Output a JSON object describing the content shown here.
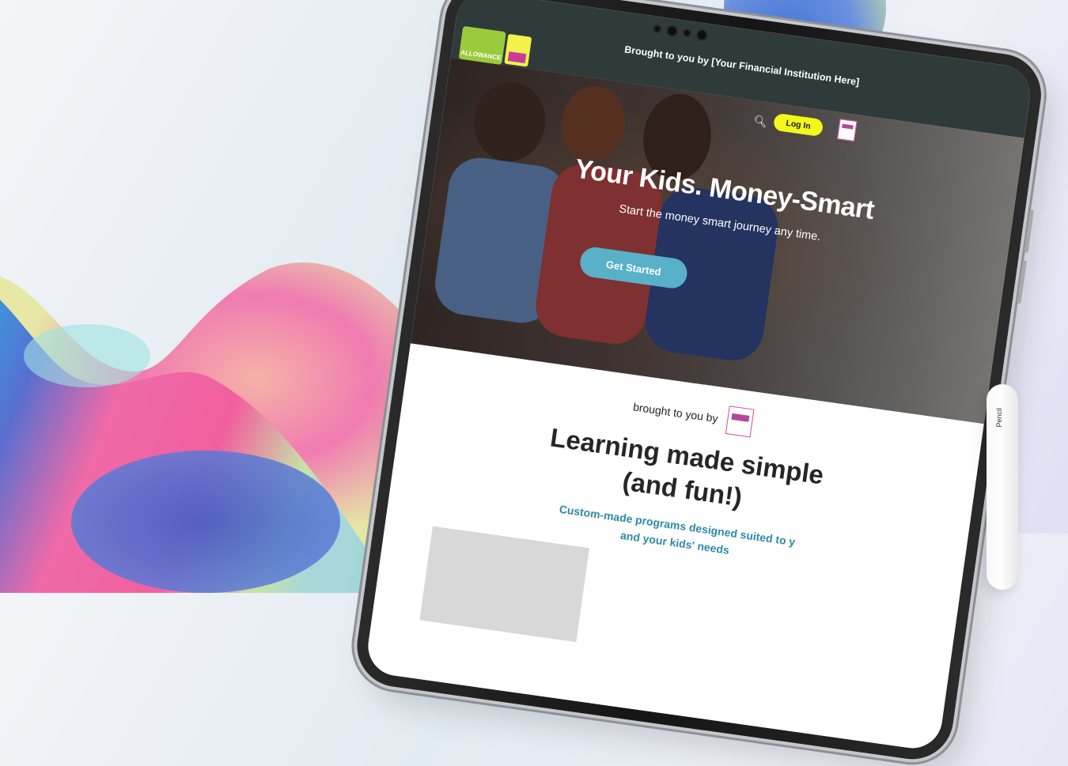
{
  "tablet": {
    "top_banner": "Brought to you by [Your Financial Institution Here]",
    "header": {
      "logo_text": "ALLOWANCE",
      "login_label": "Log In"
    },
    "hero": {
      "title": "Your Kids. Money-Smart",
      "subtitle": "Start the money smart journey any time.",
      "cta_label": "Get Started"
    },
    "content": {
      "brought_by": "brought to you by",
      "title_line1": "Learning made simple",
      "title_line2": "(and fun!)",
      "description_line1": "Custom-made programs designed suited to y",
      "description_line2": "and your kids' needs"
    }
  },
  "pencil": {
    "label": "Pencil"
  },
  "colors": {
    "topbar": "#2f3a3a",
    "login_button": "#f4f71a",
    "cta_button": "#58b0c9",
    "desc_text": "#2d8aa8",
    "blob_pink": "#f05a9f"
  }
}
